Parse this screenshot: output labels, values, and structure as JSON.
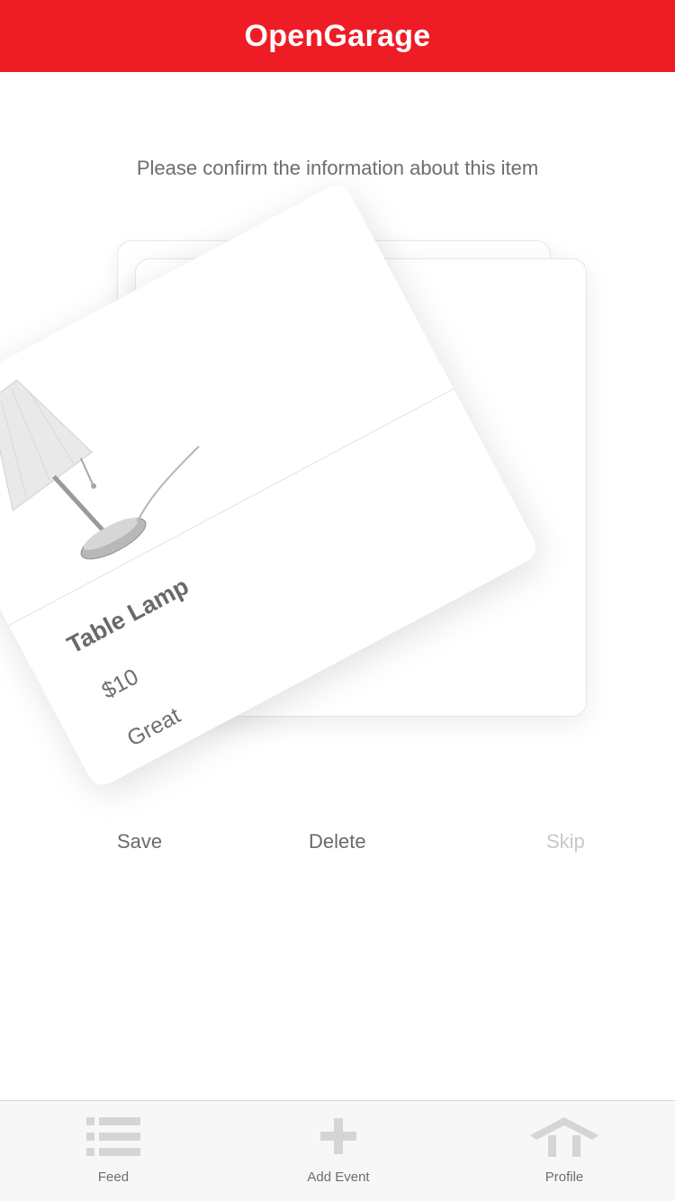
{
  "nav": {
    "title": "OpenGarage",
    "bar_color": "#ee1c25"
  },
  "prompt": {
    "text": "Please confirm the information about this item"
  },
  "card": {
    "title": "Table Lamp",
    "price": "$10",
    "condition": "Great",
    "image_icon": "table-lamp-photo"
  },
  "actions": {
    "save": "Save",
    "delete": "Delete",
    "skip": "Skip"
  },
  "tabs": [
    {
      "label": "Feed",
      "icon": "list-icon"
    },
    {
      "label": "Add Event",
      "icon": "plus-icon"
    },
    {
      "label": "Profile",
      "icon": "house-icon"
    }
  ],
  "colors": {
    "accent": "#ee1c25",
    "tab_icon": "#d5d5d5",
    "disabled_text": "#c8c8c8"
  }
}
